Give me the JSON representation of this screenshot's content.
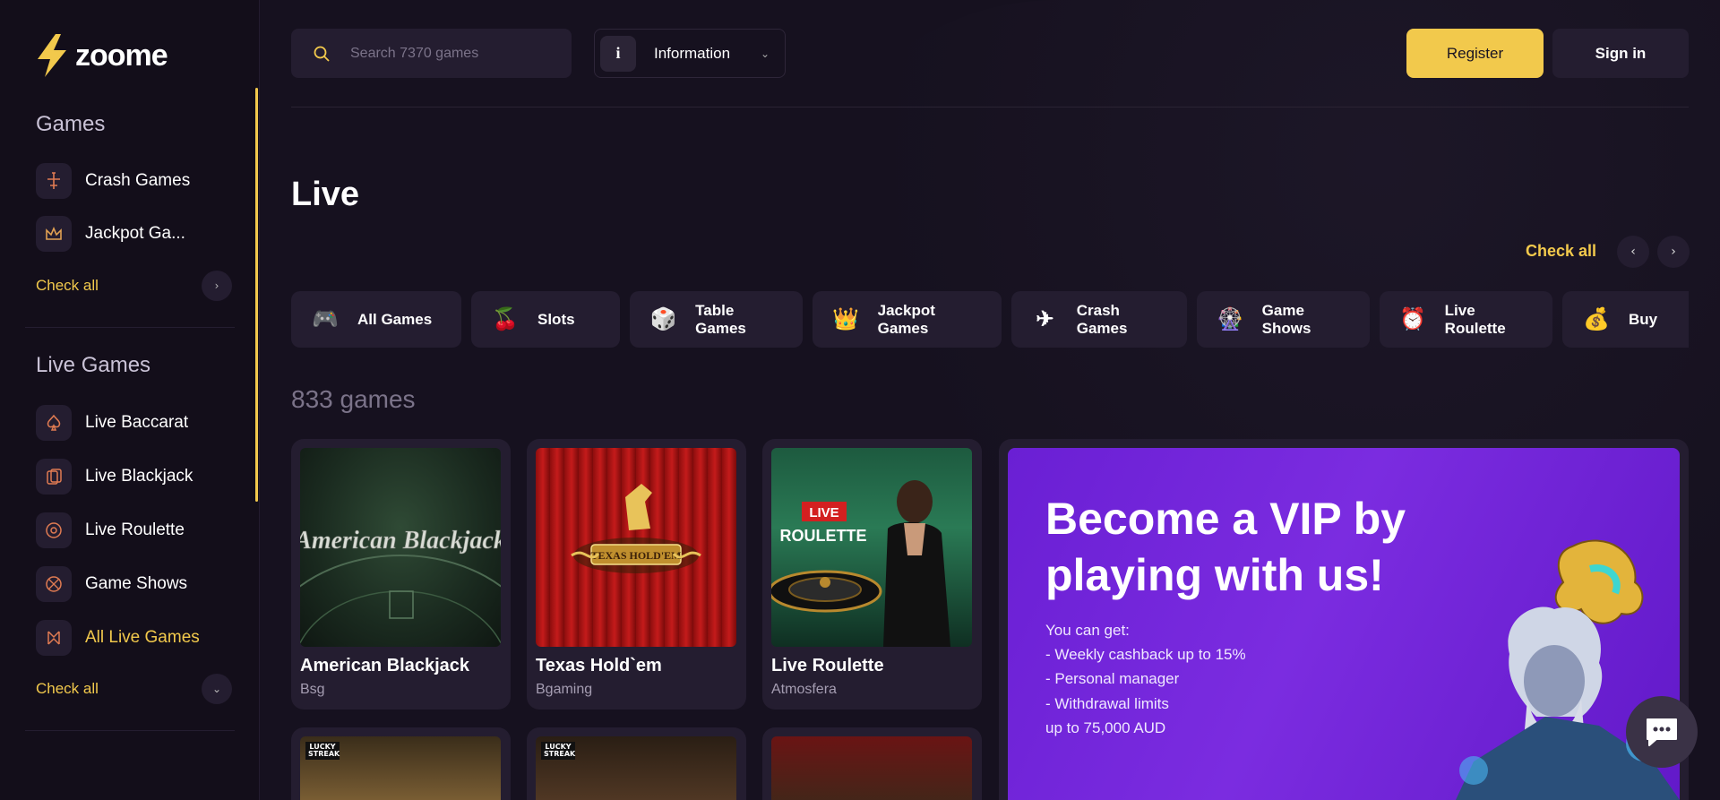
{
  "brand": {
    "name": "zoome"
  },
  "sidebar": {
    "games_title": "Games",
    "games_items": [
      {
        "label": "Crash Games",
        "icon": "crash-icon"
      },
      {
        "label": "Jackpot Ga...",
        "icon": "crown-icon"
      }
    ],
    "games_check_all": "Check all",
    "live_title": "Live Games",
    "live_items": [
      {
        "label": "Live Baccarat",
        "icon": "spade-icon"
      },
      {
        "label": "Live Blackjack",
        "icon": "cards-icon"
      },
      {
        "label": "Live Roulette",
        "icon": "roulette-icon"
      },
      {
        "label": "Game Shows",
        "icon": "wheel-icon"
      },
      {
        "label": "All Live Games",
        "icon": "dealer-icon"
      }
    ],
    "live_check_all": "Check all"
  },
  "header": {
    "search_placeholder": "Search 7370 games",
    "info_icon": "i",
    "info_label": "Information",
    "register": "Register",
    "signin": "Sign in"
  },
  "main": {
    "title": "Live",
    "check_all": "Check all",
    "categories": [
      {
        "label": "All Games",
        "icon": "🎮"
      },
      {
        "label": "Slots",
        "icon": "🍒"
      },
      {
        "label": "Table Games",
        "icon": "🎲"
      },
      {
        "label": "Jackpot Games",
        "icon": "👑"
      },
      {
        "label": "Crash Games",
        "icon": "✈"
      },
      {
        "label": "Game Shows",
        "icon": "🎡"
      },
      {
        "label": "Live Roulette",
        "icon": "⏰"
      },
      {
        "label": "Buy",
        "icon": "💰"
      }
    ],
    "games_count": "833 games",
    "games": [
      {
        "title": "American Blackjack",
        "provider": "Bsg",
        "art_text": "American Blackjack"
      },
      {
        "title": "Texas Hold`em",
        "provider": "Bgaming",
        "art_text": "TEXAS HOLD'EM"
      },
      {
        "title": "Live Roulette",
        "provider": "Atmosfera",
        "art_badge": "LIVE",
        "art_text": "ROULETTE"
      }
    ],
    "second_row_badges": [
      "LUCKY STREAK",
      "LUCKY STREAK"
    ]
  },
  "vip": {
    "title": "Become a VIP by playing with us!",
    "lines": [
      "You can get:",
      "- Weekly cashback up to 15%",
      "- Personal manager",
      "- Withdrawal limits",
      "up to 75,000 AUD"
    ]
  },
  "colors": {
    "accent": "#f2c94c",
    "bg": "#16111f",
    "card": "#241d30",
    "vip": "#7b2ce0"
  }
}
